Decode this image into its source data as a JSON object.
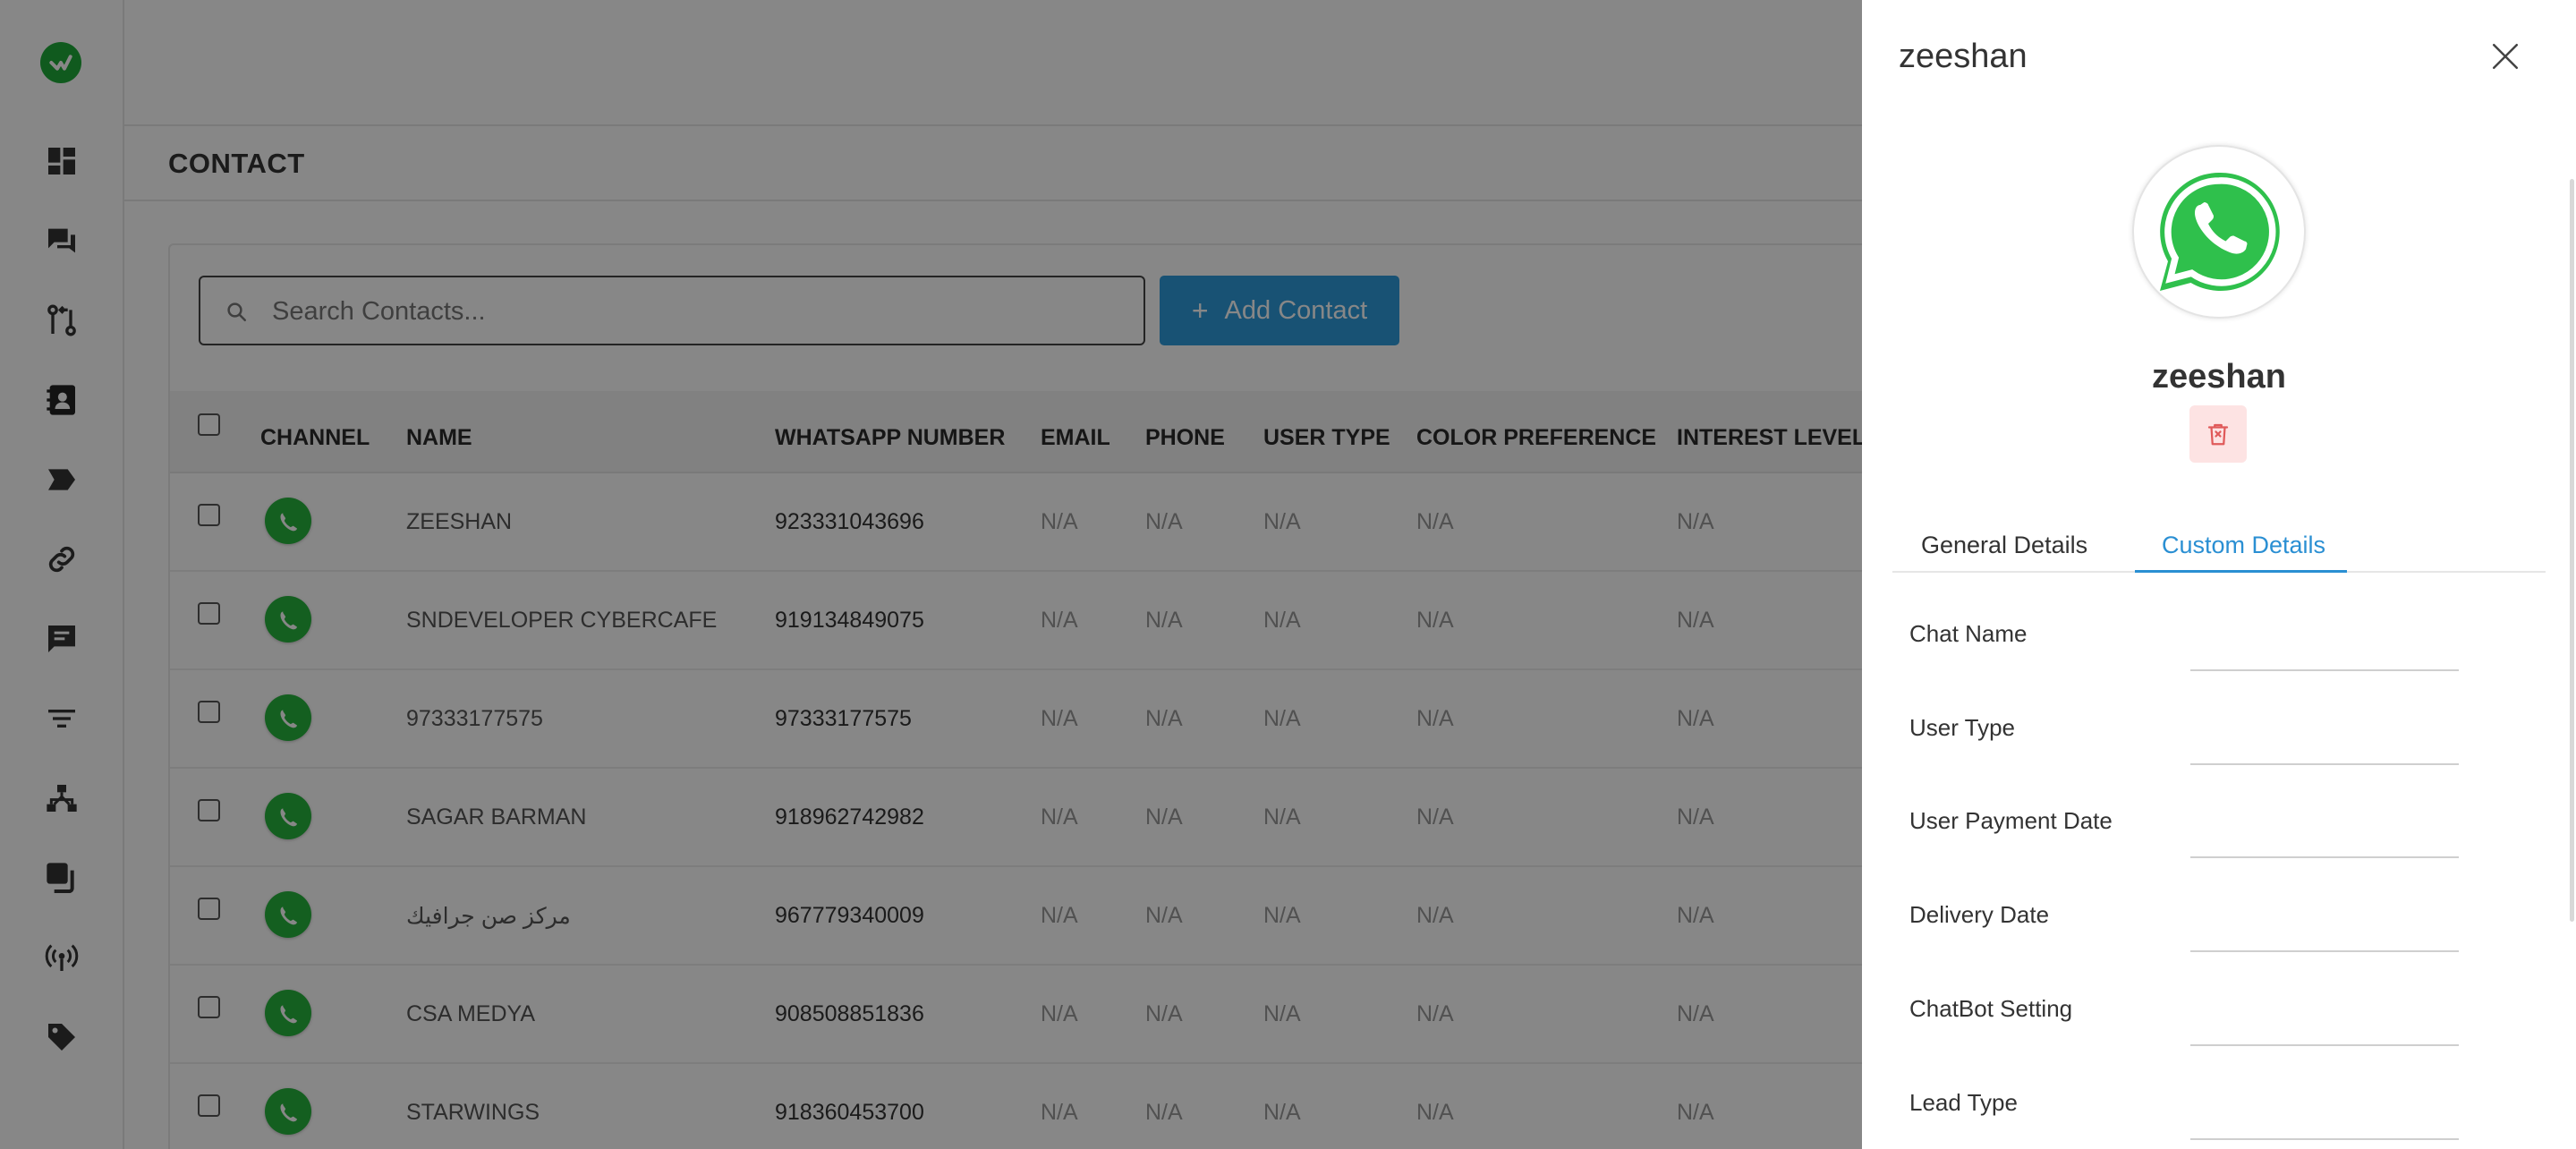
{
  "sidebar": {
    "logo": "whatsapp-check-logo",
    "items": [
      {
        "name": "dashboard-icon"
      },
      {
        "name": "chats-icon"
      },
      {
        "name": "flows-icon"
      },
      {
        "name": "contacts-icon"
      },
      {
        "name": "tags-icon"
      },
      {
        "name": "link-icon"
      },
      {
        "name": "message-icon"
      },
      {
        "name": "filter-icon"
      },
      {
        "name": "integration-icon"
      },
      {
        "name": "templates-icon"
      },
      {
        "name": "broadcast-icon"
      },
      {
        "name": "price-tag-icon"
      }
    ]
  },
  "page": {
    "title": "CONTACT"
  },
  "search": {
    "placeholder": "Search Contacts..."
  },
  "add_contact": {
    "plus": "+",
    "label": "Add Contact"
  },
  "table": {
    "headers": [
      "CHANNEL",
      "NAME",
      "WHATSAPP NUMBER",
      "EMAIL",
      "PHONE",
      "USER TYPE",
      "COLOR PREFERENCE",
      "INTEREST LEVEL"
    ],
    "rows": [
      {
        "name": "ZEESHAN",
        "whatsapp": "923331043696",
        "email": "N/A",
        "phone": "N/A",
        "user_type": "N/A",
        "color": "N/A",
        "interest": "N/A"
      },
      {
        "name": "SNDEVELOPER CYBERCAFE",
        "whatsapp": "919134849075",
        "email": "N/A",
        "phone": "N/A",
        "user_type": "N/A",
        "color": "N/A",
        "interest": "N/A"
      },
      {
        "name": "97333177575",
        "whatsapp": "97333177575",
        "email": "N/A",
        "phone": "N/A",
        "user_type": "N/A",
        "color": "N/A",
        "interest": "N/A"
      },
      {
        "name": "SAGAR BARMAN",
        "whatsapp": "918962742982",
        "email": "N/A",
        "phone": "N/A",
        "user_type": "N/A",
        "color": "N/A",
        "interest": "N/A"
      },
      {
        "name": "مرکز صن جرافیك",
        "whatsapp": "967779340009",
        "email": "N/A",
        "phone": "N/A",
        "user_type": "N/A",
        "color": "N/A",
        "interest": "N/A"
      },
      {
        "name": "CSA MEDYA",
        "whatsapp": "908508851836",
        "email": "N/A",
        "phone": "N/A",
        "user_type": "N/A",
        "color": "N/A",
        "interest": "N/A"
      },
      {
        "name": "STARWINGS",
        "whatsapp": "918360453700",
        "email": "N/A",
        "phone": "N/A",
        "user_type": "N/A",
        "color": "N/A",
        "interest": "N/A"
      }
    ]
  },
  "panel": {
    "title": "zeeshan",
    "profile_name": "zeeshan",
    "tabs": [
      {
        "label": "General Details",
        "active": false
      },
      {
        "label": "Custom Details",
        "active": true
      }
    ],
    "fields": [
      {
        "label": "Chat Name",
        "value": ""
      },
      {
        "label": "User Type",
        "value": ""
      },
      {
        "label": "User Payment Date",
        "value": ""
      },
      {
        "label": "Delivery Date",
        "value": ""
      },
      {
        "label": "ChatBot Setting",
        "value": ""
      },
      {
        "label": "Lead Type",
        "value": ""
      }
    ]
  },
  "colors": {
    "accent": "#2e9bdc",
    "whatsapp_green": "#27b43e",
    "tab_active": "#2a8fd3",
    "delete_bg": "#fde3e3",
    "delete_icon": "#e05a5a",
    "overlay": "rgba(0,0,0,0.47)"
  }
}
